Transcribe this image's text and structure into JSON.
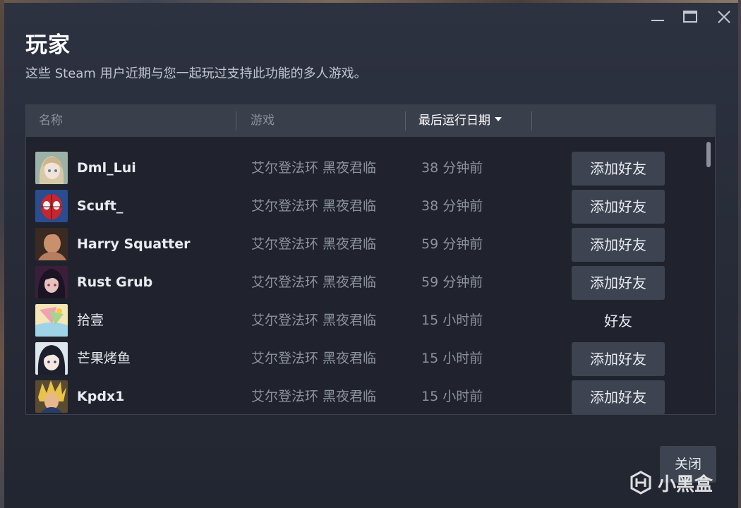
{
  "dialog": {
    "title": "玩家",
    "subtitle": "这些 Steam 用户近期与您一起玩过支持此功能的多人游戏。"
  },
  "table": {
    "columns": {
      "name": "名称",
      "game": "游戏",
      "date": "最后运行日期"
    },
    "rows": [
      {
        "name": "Dml_Lui",
        "game": "艾尔登法环 黑夜君临",
        "date": "38 分钟前",
        "action": "添加好友",
        "is_friend": false,
        "avatar": "anime-girl-avatar"
      },
      {
        "name": "Scuft_",
        "game": "艾尔登法环 黑夜君临",
        "date": "38 分钟前",
        "action": "添加好友",
        "is_friend": false,
        "avatar": "spiderman-avatar"
      },
      {
        "name": "Harry Squatter",
        "game": "艾尔登法环 黑夜君临",
        "date": "59 分钟前",
        "action": "添加好友",
        "is_friend": false,
        "avatar": "man-portrait-avatar"
      },
      {
        "name": "Rust Grub",
        "game": "艾尔登法环 黑夜君临",
        "date": "59 分钟前",
        "action": "添加好友",
        "is_friend": false,
        "avatar": "dark-hair-character-avatar"
      },
      {
        "name": "拾壹",
        "game": "艾尔登法环 黑夜君临",
        "date": "15 小时前",
        "action": "好友",
        "is_friend": true,
        "avatar": "cartoon-beach-avatar"
      },
      {
        "name": "芒果烤鱼",
        "game": "艾尔登法环 黑夜君临",
        "date": "15 小时前",
        "action": "添加好友",
        "is_friend": false,
        "avatar": "anime-dark-hair-avatar"
      },
      {
        "name": "Kpdx1",
        "game": "艾尔登法环 黑夜君临",
        "date": "15 小时前",
        "action": "添加好友",
        "is_friend": false,
        "avatar": "spiky-hair-avatar"
      }
    ]
  },
  "footer": {
    "close_label": "关闭",
    "watermark": "小黑盒"
  },
  "colors": {
    "background": "#272b37",
    "header": "#3a3f4c",
    "button": "#3d4350",
    "muted_text": "#8b929e",
    "text": "#e8ebf0"
  }
}
